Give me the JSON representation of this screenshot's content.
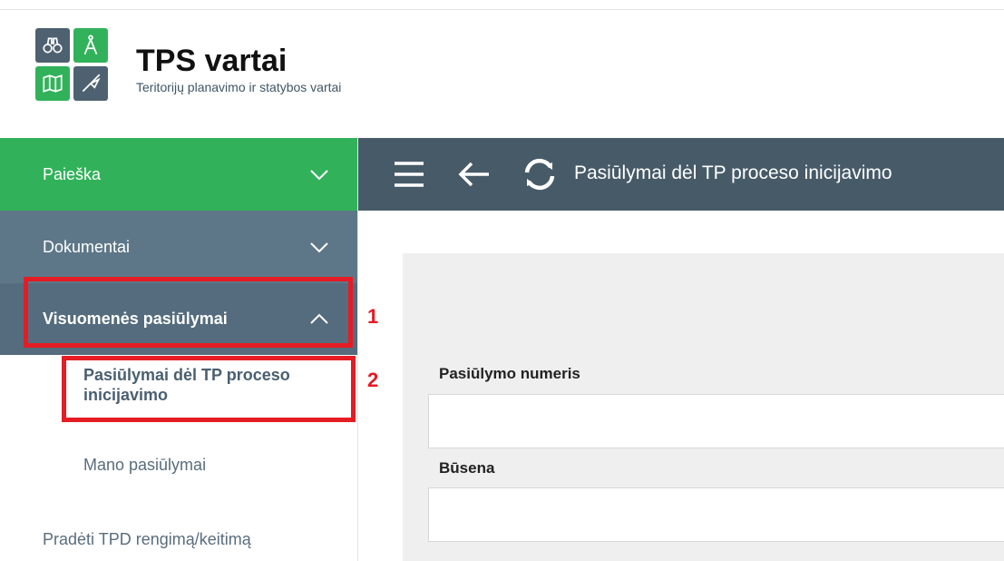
{
  "app": {
    "title": "TPS vartai",
    "subtitle": "Teritorijų planavimo ir statybos vartai"
  },
  "logo": {
    "tiles": [
      "binoculars-icon",
      "compass-icon",
      "map-icon",
      "trowel-icon"
    ]
  },
  "sidebar": {
    "items": [
      {
        "label": "Paieška",
        "expanded": false,
        "color": "#31b25a"
      },
      {
        "label": "Dokumentai",
        "expanded": false,
        "color": "#5e7788"
      },
      {
        "label": "Visuomenės pasiūlymai",
        "expanded": true,
        "color": "#546c7d"
      }
    ],
    "subitems": [
      "Pasiūlymai dėl TP proceso inicijavimo",
      "Mano pasiūlymai"
    ],
    "extra_item": "Pradėti TPD rengimą/keitimą"
  },
  "header": {
    "title": "Pasiūlymai dėl TP proceso inicijavimo",
    "icons": [
      "menu-icon",
      "back-arrow-icon",
      "refresh-icon"
    ]
  },
  "form": {
    "fields": [
      {
        "label": "Pasiūlymo numeris",
        "value": ""
      },
      {
        "label": "Būsena",
        "value": ""
      }
    ]
  },
  "annotations": {
    "markers": [
      "1",
      "2"
    ],
    "color": "#e51c23"
  }
}
